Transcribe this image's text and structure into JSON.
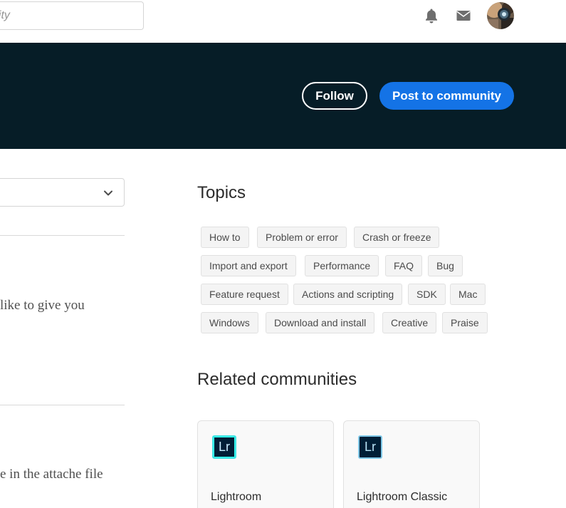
{
  "header": {
    "search_placeholder": "nity",
    "notifications_icon": "bell-icon",
    "messages_icon": "mail-icon",
    "avatar_alt": "user-avatar"
  },
  "banner": {
    "follow_label": "Follow",
    "post_label": "Post to community",
    "background_color": "#061d27",
    "accent_color": "#1473e6"
  },
  "left_column": {
    "dropdown_icon": "chevron-down-icon",
    "snippets": [
      "like to give you",
      "e in the attache file"
    ]
  },
  "topics": {
    "title": "Topics",
    "tags": [
      "How to",
      "Problem or error",
      "Crash or freeze",
      "Import and export",
      "Performance",
      "FAQ",
      "Bug",
      "Feature request",
      "Actions and scripting",
      "SDK",
      "Mac",
      "Windows",
      "Download and install",
      "Creative",
      "Praise"
    ]
  },
  "related": {
    "title": "Related communities",
    "communities": [
      {
        "logo_text": "Lr",
        "name": "Lightroom"
      },
      {
        "logo_text": "Lr",
        "name": "Lightroom Classic"
      }
    ]
  }
}
